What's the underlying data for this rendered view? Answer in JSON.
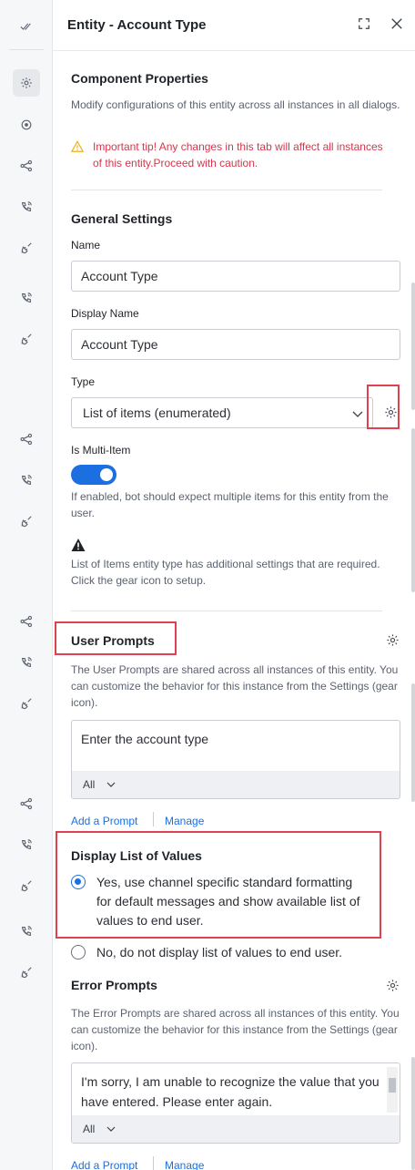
{
  "header": {
    "title": "Entity - Account Type"
  },
  "component": {
    "title": "Component Properties",
    "description": "Modify configurations of this entity across all instances in all dialogs.",
    "warning": "Important tip! Any changes in this tab will affect all instances of this entity.Proceed with caution."
  },
  "general": {
    "title": "General Settings",
    "name_label": "Name",
    "name_value": "Account Type",
    "display_name_label": "Display Name",
    "display_name_value": "Account Type",
    "type_label": "Type",
    "type_value": "List of items (enumerated)",
    "multi_item_label": "Is Multi-Item",
    "multi_item_enabled": true,
    "multi_item_help": "If enabled, bot should expect multiple items for this entity from the user.",
    "list_note": "List of Items entity type has additional settings that are required. Click the gear icon to setup."
  },
  "user_prompts": {
    "title": "User Prompts",
    "description": "The User Prompts are shared across all instances of this entity. You can customize the behavior for this instance from the Settings (gear icon).",
    "prompt_text": "Enter the account type",
    "language": "All",
    "add_link": "Add a Prompt",
    "manage_link": "Manage"
  },
  "display_list": {
    "title": "Display List of Values",
    "option_yes": "Yes, use channel specific standard formatting for default messages and show available list of values to end user.",
    "option_no": "No, do not display list of values to end user.",
    "selected": "yes"
  },
  "error_prompts": {
    "title": "Error Prompts",
    "description": "The Error Prompts are shared across all instances of this entity. You can customize the behavior for this instance from the Settings (gear icon).",
    "prompt_text": "I'm sorry, I am unable to recognize the value that you have entered. Please enter again.",
    "language": "All",
    "add_link": "Add a Prompt",
    "manage_link": "Manage"
  },
  "colors": {
    "accent": "#1c6fe0",
    "warning": "#d9344a",
    "highlight_box": "#e0414f"
  }
}
